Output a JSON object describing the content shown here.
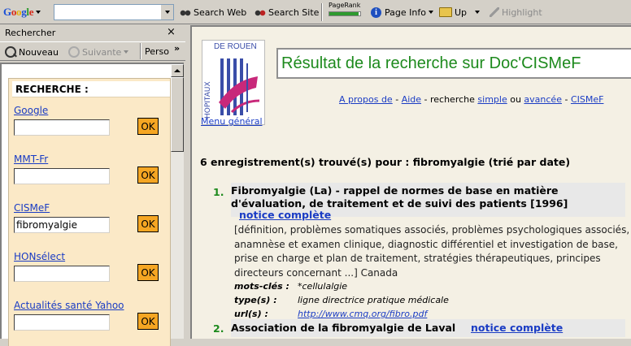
{
  "toolbar": {
    "logo": "Google",
    "search_value": "",
    "search_web": "Search Web",
    "search_site": "Search Site",
    "pagerank_label": "PageRank",
    "pagerank_level": 0.95,
    "page_info": "Page Info",
    "up": "Up",
    "highlight": "Highlight"
  },
  "search_pane": {
    "title": "Rechercher",
    "close": "×",
    "nouveau": "Nouveau",
    "suivante": "Suivante",
    "perso": "Perso",
    "overflow": "»",
    "heading": "RECHERCHE :",
    "ok_label": "OK",
    "engines": [
      {
        "name": "Google",
        "value": ""
      },
      {
        "name": "MMT-Fr",
        "value": ""
      },
      {
        "name": "CISMeF",
        "value": "fibromyalgie"
      },
      {
        "name": "HONsélect",
        "value": ""
      },
      {
        "name": "Actualités santé Yahoo",
        "value": ""
      }
    ]
  },
  "document": {
    "logo_side": "HOPITAUX",
    "logo_top": "DE ROUEN",
    "menu_general": "Menu général",
    "title": "Résultat de la recherche sur Doc'CISMeF",
    "nav": {
      "apropos": "A propos de",
      "sep1": " - ",
      "aide": "Aide",
      "sep2": " - recherche ",
      "simple": "simple",
      "ou": " ou ",
      "avancee": "avancée",
      "sep3": " - ",
      "cismef": "CISMeF"
    },
    "result_count": "6 enregistrement(s) trouvé(s) pour : fibromyalgie (trié par date)",
    "notice_label": "notice complète",
    "results": [
      {
        "num": "1.",
        "title_line1": "Fibromyalgie (La) - rappel de normes de base en matière",
        "title_line2": "d'évaluation, de traitement et de suivi des patients [1996]",
        "description": "[définition, problèmes somatiques associés, problèmes psychologiques associés, anamnèse et examen clinique, diagnostic différentiel et investigation de base, prise en charge et plan de traitement, stratégies thérapeutiques, principes directeurs concernant ...] Canada",
        "motscles_k": "mots-clés :",
        "motscles_v": "*cellulalgie",
        "type_k": "type(s) :",
        "type_v": "ligne directrice pratique médicale",
        "url_k": "url(s) :",
        "url_v": "http://www.cmq.org/fibro.pdf"
      },
      {
        "num": "2.",
        "title": "Association de la fibromyalgie de Laval"
      }
    ]
  }
}
